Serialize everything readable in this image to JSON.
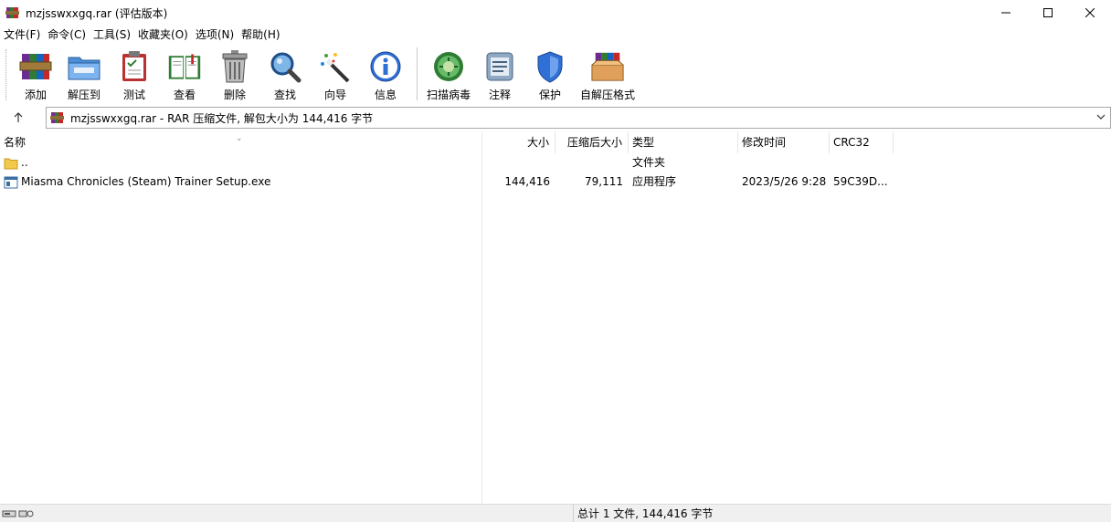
{
  "window": {
    "title": "mzjsswxxgq.rar (评估版本)",
    "controls": [
      "minimize-icon",
      "maximize-icon",
      "close-icon"
    ]
  },
  "menu": [
    {
      "label": "文件(F)"
    },
    {
      "label": "命令(C)"
    },
    {
      "label": "工具(S)"
    },
    {
      "label": "收藏夹(O)"
    },
    {
      "label": "选项(N)"
    },
    {
      "label": "帮助(H)"
    }
  ],
  "toolbar": {
    "buttons": [
      {
        "label": "添加",
        "icon": "books-add-icon"
      },
      {
        "label": "解压到",
        "icon": "folder-extract-icon"
      },
      {
        "label": "测试",
        "icon": "clipboard-test-icon"
      },
      {
        "label": "查看",
        "icon": "book-view-icon"
      },
      {
        "label": "删除",
        "icon": "trash-delete-icon"
      },
      {
        "label": "查找",
        "icon": "magnifier-find-icon"
      },
      {
        "label": "向导",
        "icon": "wand-wizard-icon"
      },
      {
        "label": "信息",
        "icon": "info-icon"
      },
      {
        "label": "扫描病毒",
        "icon": "virus-scan-icon"
      },
      {
        "label": "注释",
        "icon": "comment-icon"
      },
      {
        "label": "保护",
        "icon": "shield-protect-icon"
      },
      {
        "label": "自解压格式",
        "icon": "sfx-box-icon"
      }
    ]
  },
  "address": {
    "text": "mzjsswxxgq.rar - RAR 压缩文件, 解包大小为 144,416 字节"
  },
  "columns": {
    "name": "名称",
    "size": "大小",
    "packed": "压缩后大小",
    "type": "类型",
    "modified": "修改时间",
    "crc": "CRC32"
  },
  "rows": [
    {
      "name": "..",
      "size": "",
      "packed": "",
      "type": "文件夹",
      "modified": "",
      "crc": "",
      "icon": "folder-icon"
    },
    {
      "name": "Miasma Chronicles (Steam) Trainer Setup.exe",
      "size": "144,416",
      "packed": "79,111",
      "type": "应用程序",
      "modified": "2023/5/26 9:28",
      "crc": "59C39D...",
      "icon": "exe-file-icon"
    }
  ],
  "status": {
    "summary": "总计 1 文件, 144,416 字节"
  },
  "colors": {
    "accent_green": "#3a8d2e",
    "folder_yellow": "#f3c94b",
    "shield_blue": "#2f6fd6"
  }
}
